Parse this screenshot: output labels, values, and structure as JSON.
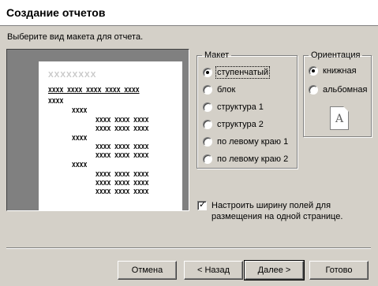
{
  "window": {
    "title": "Создание отчетов"
  },
  "prompt": "Выберите вид макета для отчета.",
  "preview": {
    "title_placeholder": "XXXXXXXX",
    "header_row": "XXXX XXXX XXXX XXXX XXXX",
    "rows": [
      "XXXX",
      "XXXX",
      "XXXX XXXX XXXX",
      "XXXX XXXX XXXX",
      "XXXX",
      "XXXX XXXX XXXX",
      "XXXX XXXX XXXX",
      "XXXX",
      "XXXX XXXX XXXX",
      "XXXX XXXX XXXX",
      "XXXX XXXX XXXX"
    ]
  },
  "layout_group": {
    "legend": "Макет",
    "options": [
      {
        "label": "ступенчатый",
        "selected": true
      },
      {
        "label": "блок",
        "selected": false
      },
      {
        "label": "структура 1",
        "selected": false
      },
      {
        "label": "структура 2",
        "selected": false
      },
      {
        "label": "по левому краю 1",
        "selected": false
      },
      {
        "label": "по левому краю 2",
        "selected": false
      }
    ]
  },
  "orientation_group": {
    "legend": "Ориентация",
    "options": [
      {
        "label": "книжная",
        "selected": true
      },
      {
        "label": "альбомная",
        "selected": false
      }
    ],
    "icon_letter": "A"
  },
  "fit_checkbox": {
    "label": "Настроить ширину полей для размещения на одной странице.",
    "checked": true
  },
  "buttons": {
    "cancel": "Отмена",
    "back": "< Назад",
    "next": "Далее >",
    "done": "Готово"
  }
}
